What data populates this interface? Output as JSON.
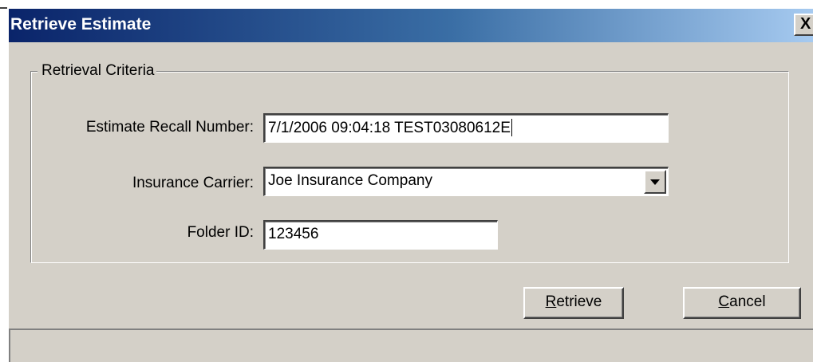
{
  "window": {
    "title": "Retrieve Estimate",
    "close_label": "X"
  },
  "group": {
    "label": "Retrieval Criteria"
  },
  "fields": {
    "recall_number": {
      "label": "Estimate Recall Number:",
      "value": "7/1/2006 09:04:18 TEST03080612E"
    },
    "insurance_carrier": {
      "label": "Insurance Carrier:",
      "value": "Joe Insurance Company"
    },
    "folder_id": {
      "label": "Folder ID:",
      "value": "123456"
    }
  },
  "buttons": {
    "retrieve": {
      "accelerator": "R",
      "rest": "etrieve"
    },
    "cancel": {
      "accelerator": "C",
      "rest": "ancel"
    }
  },
  "colors": {
    "titlebar_start": "#0a246a",
    "titlebar_end": "#a6caf0",
    "dialog_face": "#d4d0c8"
  }
}
